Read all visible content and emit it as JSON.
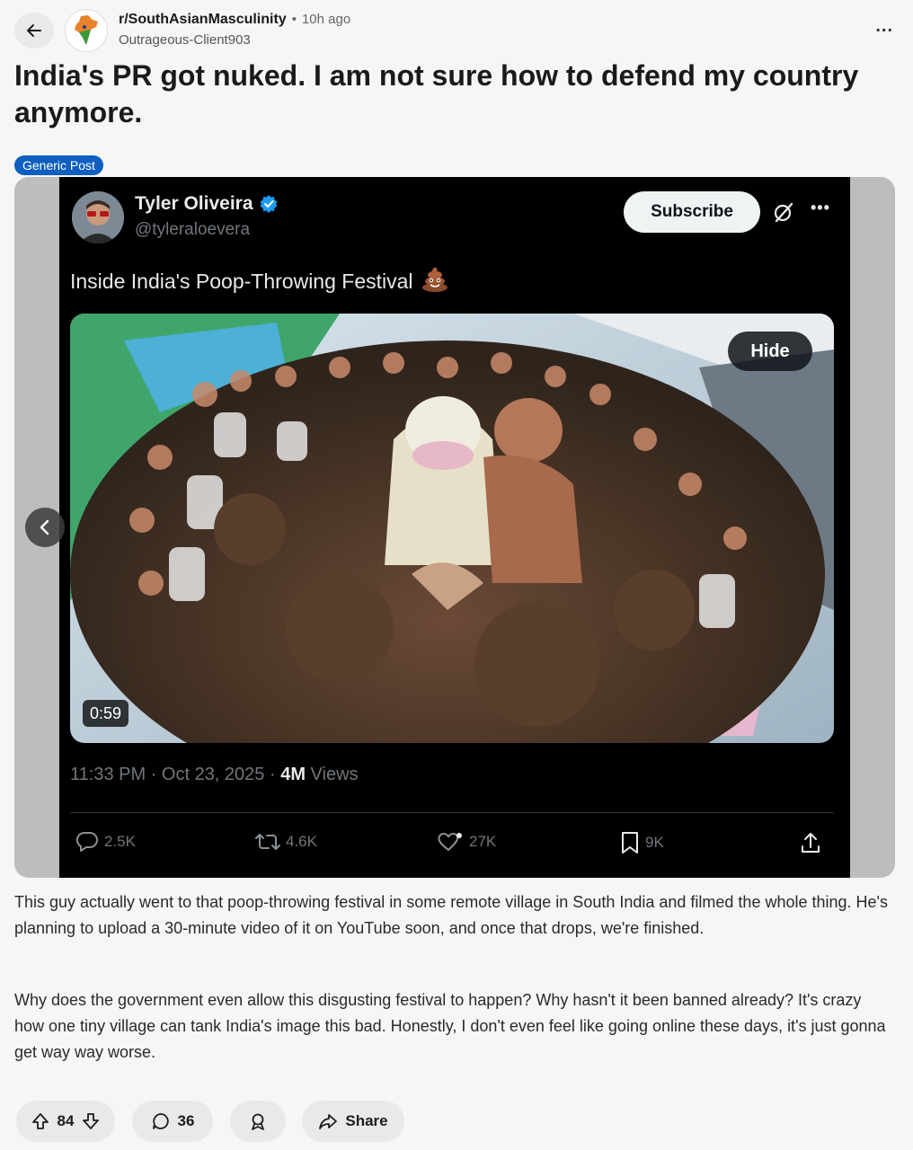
{
  "header": {
    "subreddit": "r/SouthAsianMasculinity",
    "separator": "•",
    "time": "10h ago",
    "author": "Outrageous-Client903",
    "more": "..."
  },
  "post": {
    "title": "India's PR got nuked. I am not sure how to defend my country anymore.",
    "flair": "Generic Post",
    "body": [
      "This guy actually went to that poop-throwing festival in some remote village in South India and filmed the whole thing. He's planning to upload a 30-minute video of it on YouTube soon, and once that drops, we're finished.",
      "Why does the government even allow this disgusting festival to happen? Why hasn't it been banned already? It's crazy how one tiny village can tank India's image this bad. Honestly, I don't even feel like going online these days, it's just gonna get way way worse."
    ]
  },
  "tweet": {
    "name": "Tyler Oliveira",
    "handle": "@tyleraloevera",
    "subscribe_label": "Subscribe",
    "more": "•••",
    "text": "Inside India's Poop-Throwing Festival",
    "emoji": "poop-emoji",
    "hide_label": "Hide",
    "duration": "0:59",
    "timestamp": "11:33 PM · Oct 23, 2025 · ",
    "views_count": "4M",
    "views_label": " Views",
    "stats": {
      "replies": "2.5K",
      "reposts": "4.6K",
      "likes": "27K",
      "bookmarks": "9K"
    }
  },
  "actions": {
    "votes": "84",
    "comments": "36",
    "share_label": "Share"
  },
  "colors": {
    "flair_bg": "#0e5fbf",
    "verified": "#1d9bf0",
    "page_bg": "#f6f6f6",
    "tweet_bg": "#000000"
  }
}
